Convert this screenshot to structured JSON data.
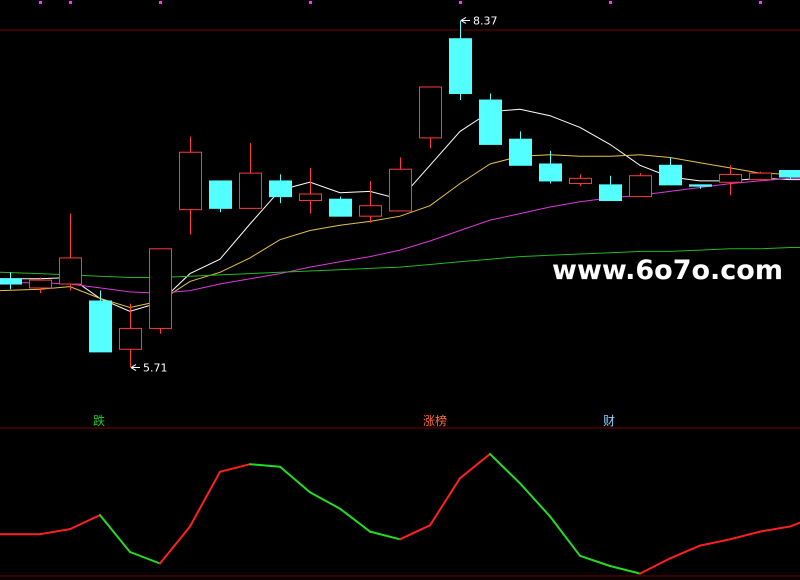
{
  "chart_data": [
    {
      "type": "candlestick",
      "high_marker": "8.37",
      "low_marker": "5.71",
      "colors": {
        "up": "#ff3b3b",
        "down": "#54ffff",
        "ma_short": "#ffffff",
        "ma_mid": "#e6c24a",
        "ma_long": "#d93ad9",
        "ma_longest": "#22b822",
        "gridline": "#7a0000"
      },
      "candles": [
        {
          "o": 6.39,
          "c": 6.35,
          "h": 6.44,
          "l": 6.31
        },
        {
          "o": 6.32,
          "c": 6.38,
          "h": 6.4,
          "l": 6.28
        },
        {
          "o": 6.35,
          "c": 6.55,
          "h": 6.89,
          "l": 6.3
        },
        {
          "o": 6.22,
          "c": 5.83,
          "h": 6.3,
          "l": 5.83
        },
        {
          "o": 5.85,
          "c": 6.01,
          "h": 6.2,
          "l": 5.71
        },
        {
          "o": 6.01,
          "c": 6.62,
          "h": 6.62,
          "l": 5.97
        },
        {
          "o": 6.92,
          "c": 7.36,
          "h": 7.48,
          "l": 6.73
        },
        {
          "o": 7.14,
          "c": 6.93,
          "h": 7.14,
          "l": 6.9
        },
        {
          "o": 6.93,
          "c": 7.2,
          "h": 7.43,
          "l": 6.93
        },
        {
          "o": 7.14,
          "c": 7.02,
          "h": 7.19,
          "l": 6.97
        },
        {
          "o": 6.99,
          "c": 7.04,
          "h": 7.24,
          "l": 6.89
        },
        {
          "o": 7.0,
          "c": 6.87,
          "h": 7.02,
          "l": 6.87
        },
        {
          "o": 6.87,
          "c": 6.95,
          "h": 7.14,
          "l": 6.82
        },
        {
          "o": 6.91,
          "c": 7.23,
          "h": 7.32,
          "l": 6.91
        },
        {
          "o": 7.47,
          "c": 7.86,
          "h": 7.86,
          "l": 7.39
        },
        {
          "o": 8.23,
          "c": 7.81,
          "h": 8.37,
          "l": 7.76
        },
        {
          "o": 7.76,
          "c": 7.42,
          "h": 7.81,
          "l": 7.42
        },
        {
          "o": 7.46,
          "c": 7.26,
          "h": 7.52,
          "l": 7.26
        },
        {
          "o": 7.27,
          "c": 7.14,
          "h": 7.37,
          "l": 7.12
        },
        {
          "o": 7.12,
          "c": 7.16,
          "h": 7.19,
          "l": 7.1
        },
        {
          "o": 7.11,
          "c": 6.99,
          "h": 7.18,
          "l": 6.99
        },
        {
          "o": 7.02,
          "c": 7.18,
          "h": 7.2,
          "l": 7.02
        },
        {
          "o": 7.26,
          "c": 7.11,
          "h": 7.32,
          "l": 7.11
        },
        {
          "o": 7.11,
          "c": 7.1,
          "h": 7.11,
          "l": 7.08
        },
        {
          "o": 7.13,
          "c": 7.19,
          "h": 7.26,
          "l": 7.03
        },
        {
          "o": 7.15,
          "c": 7.2,
          "h": 7.21,
          "l": 7.14
        },
        {
          "o": 7.22,
          "c": 7.17,
          "h": 7.22,
          "l": 7.15
        }
      ],
      "series": [
        {
          "values": [
            6.39,
            6.39,
            6.4,
            6.24,
            6.14,
            6.21,
            6.43,
            6.54,
            6.81,
            7.07,
            7.13,
            7.05,
            7.06,
            7.0,
            7.26,
            7.52,
            7.67,
            7.69,
            7.64,
            7.55,
            7.42,
            7.26,
            7.17,
            7.14,
            7.14,
            7.16,
            7.15
          ]
        },
        {
          "values": [
            6.3,
            6.31,
            6.33,
            6.24,
            6.17,
            6.22,
            6.37,
            6.44,
            6.55,
            6.69,
            6.76,
            6.8,
            6.83,
            6.87,
            6.95,
            7.12,
            7.27,
            7.33,
            7.34,
            7.33,
            7.33,
            7.34,
            7.32,
            7.28,
            7.24,
            7.2,
            7.19
          ]
        },
        {
          "values": [
            6.36,
            6.36,
            6.35,
            6.32,
            6.29,
            6.28,
            6.3,
            6.35,
            6.39,
            6.43,
            6.48,
            6.52,
            6.56,
            6.61,
            6.68,
            6.76,
            6.84,
            6.89,
            6.94,
            6.98,
            7.01,
            7.03,
            7.06,
            7.09,
            7.12,
            7.14,
            7.16
          ]
        },
        {
          "values": [
            6.44,
            6.43,
            6.42,
            6.41,
            6.4,
            6.4,
            6.41,
            6.42,
            6.43,
            6.44,
            6.45,
            6.46,
            6.47,
            6.48,
            6.5,
            6.52,
            6.54,
            6.56,
            6.57,
            6.58,
            6.59,
            6.6,
            6.6,
            6.61,
            6.62,
            6.62,
            6.63
          ]
        }
      ],
      "signal_labels": [
        {
          "index": 3,
          "text": "跌",
          "color": "#22cc22"
        },
        {
          "index": 14,
          "text": "涨榜",
          "color": "#ff6b3b"
        },
        {
          "index": 20,
          "text": "财",
          "color": "#8fd1ff"
        }
      ],
      "ylim": [
        5.4,
        8.45
      ]
    },
    {
      "type": "line",
      "colors": {
        "rising": "#ff2020",
        "falling": "#22dd22"
      },
      "x": [
        0,
        1,
        2,
        3,
        4,
        5,
        6,
        7,
        8,
        9,
        10,
        11,
        12,
        13,
        14,
        15,
        16,
        17,
        18,
        19,
        20,
        21,
        22,
        23,
        24,
        25,
        26,
        27
      ],
      "values": [
        34,
        34,
        38,
        49,
        20,
        11,
        40,
        83,
        89,
        87,
        67,
        54,
        36,
        30,
        41,
        78,
        97,
        74,
        48,
        17,
        9,
        3,
        15,
        25,
        30,
        36,
        40,
        43
      ],
      "ylim": [
        -2,
        108
      ]
    }
  ],
  "watermark": "www.6o7o.com"
}
